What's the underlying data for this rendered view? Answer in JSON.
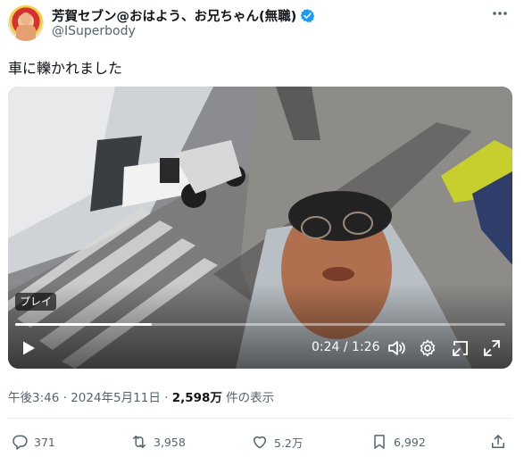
{
  "author": {
    "display_name": "芳賀セブン@おはよう、お兄ちゃん(無職)",
    "handle": "@ISuperbody",
    "verified_icon": "verified-badge-icon",
    "colors": {
      "verified": "#1d9bf0"
    }
  },
  "tweet": {
    "text": "車に轢かれました"
  },
  "video": {
    "badge": "プレイ",
    "current_time": "0:24",
    "total_time": "1:26",
    "time_display": "0:24 / 1:26",
    "progress_fraction": 0.279,
    "icons": [
      "play-icon",
      "volume-icon",
      "settings-icon",
      "picture-in-picture-icon",
      "fullscreen-icon"
    ]
  },
  "meta": {
    "timestamp": "午後3:46 · 2024年5月11日 · ",
    "views_count": "2,598万",
    "views_label": " 件の表示"
  },
  "actions": {
    "reply_count": "371",
    "retweet_count": "3,958",
    "like_count": "5.2万",
    "bookmark_count": "6,992"
  }
}
